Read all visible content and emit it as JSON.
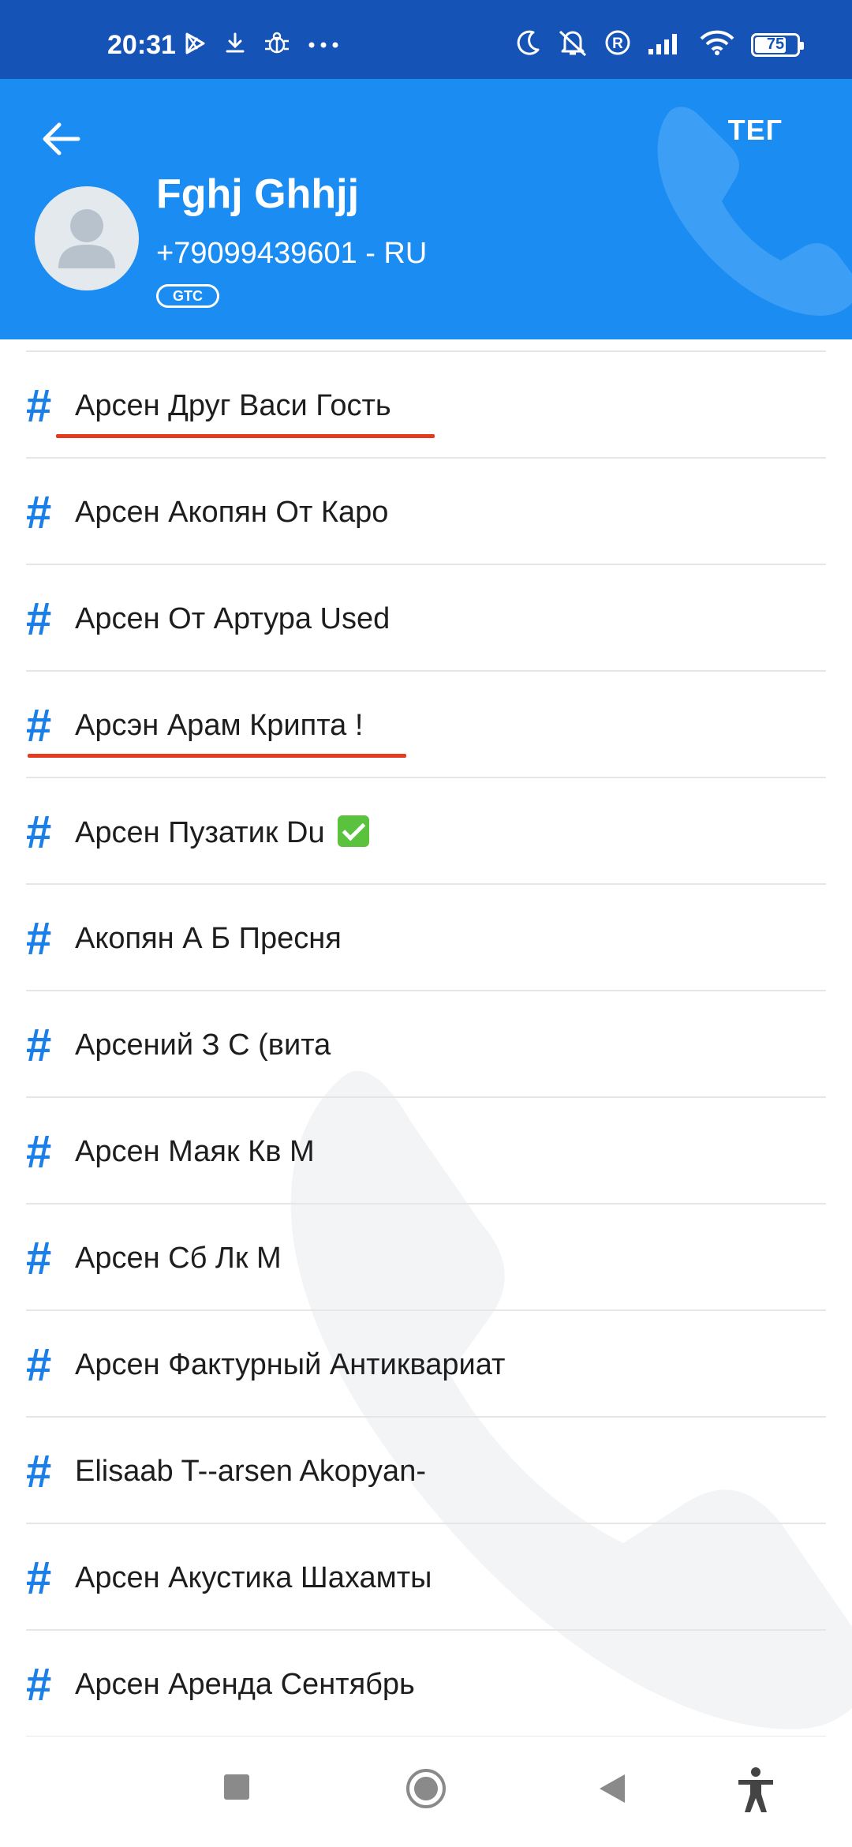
{
  "status_bar": {
    "time": "20:31",
    "left_icons": [
      "play-store-icon",
      "download-icon",
      "bug-icon",
      "more-dots-icon"
    ],
    "right_icons": [
      "moon-icon",
      "mute-icon",
      "roaming-icon",
      "signal-icon",
      "wifi-icon",
      "battery-icon"
    ],
    "battery": "75",
    "battery_percent": 75
  },
  "header": {
    "back_icon": "arrow-left-icon",
    "tag_button": "ТЕГ",
    "name": "Fghj Ghhjj",
    "phone": "+79099439601 - RU",
    "badge": "GTC",
    "background_color": "#1a8cf2"
  },
  "tags": [
    {
      "label": "Арсен Друг Васи Гость",
      "underlined": true
    },
    {
      "label": "Арсен Акопян От Каро"
    },
    {
      "label": "Арсен От Артура Used"
    },
    {
      "label": "Арсэн Арам Крипта !",
      "underlined": true
    },
    {
      "label": "Арсен Пузатик Du",
      "emoji": "✅"
    },
    {
      "label": "Акопян А Б Пресня"
    },
    {
      "label": "Арсений З С (вита"
    },
    {
      "label": "Арсен Маяк Кв М"
    },
    {
      "label": "Арсен Сб Лк М"
    },
    {
      "label": "Арсен Фактурный Антиквариат"
    },
    {
      "label": "Elisaab T--arsen Akopyan-"
    },
    {
      "label": "Арсен Акустика Шахамты"
    },
    {
      "label": "Арсен Аренда Сентябрь"
    }
  ],
  "tag_symbol": "#",
  "colors": {
    "accent": "#1a7fe8",
    "status_bar": "#1553b6",
    "underline": "#e63a1f"
  },
  "nav_bar": [
    "recents-square-icon",
    "home-circle-icon",
    "back-triangle-icon",
    "accessibility-icon"
  ]
}
